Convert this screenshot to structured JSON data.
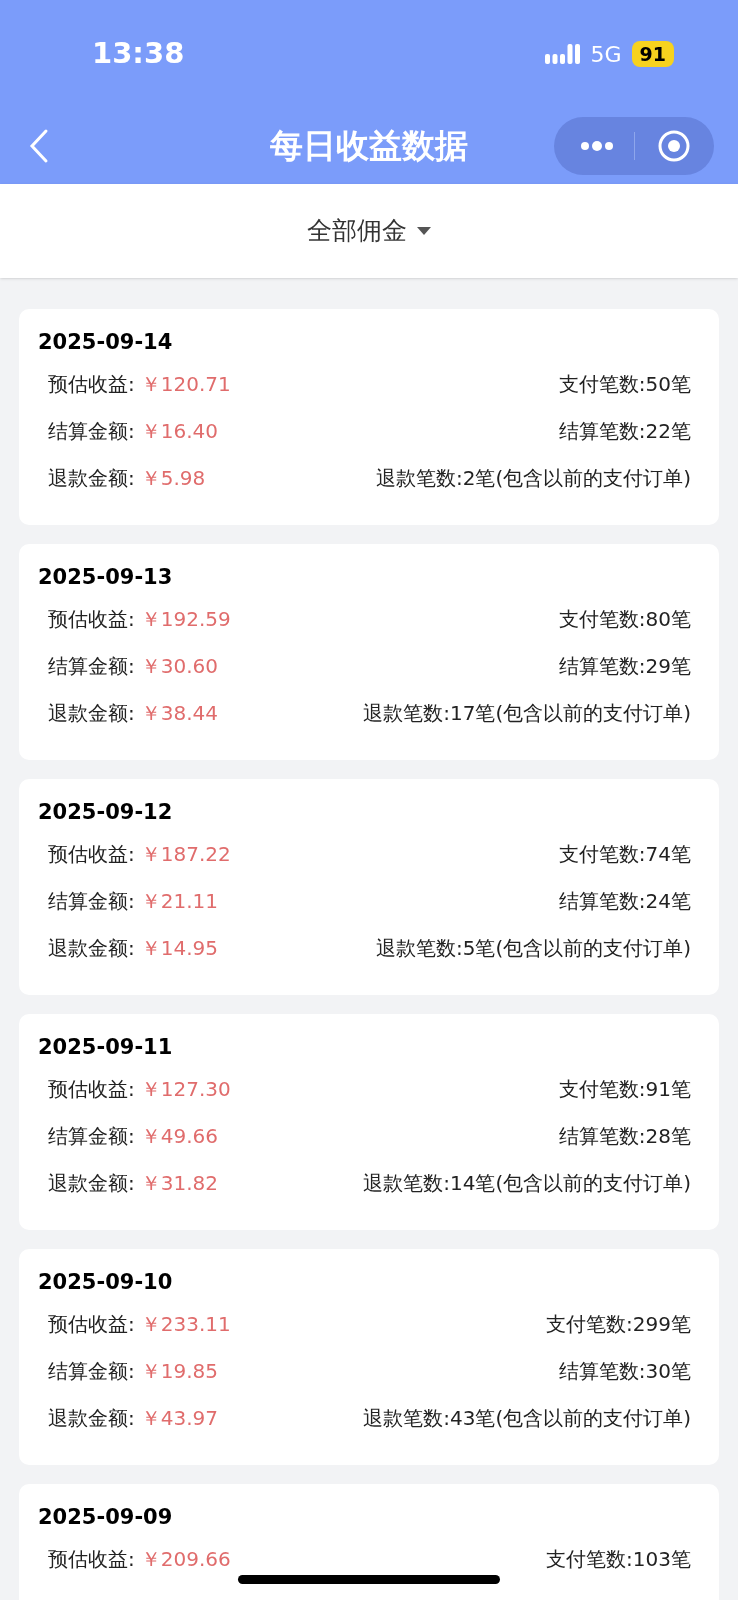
{
  "status_bar": {
    "time": "13:38",
    "network": "5G",
    "battery": "91"
  },
  "nav": {
    "title": "每日收益数据"
  },
  "filter": {
    "label": "全部佣金"
  },
  "days": [
    {
      "date": "2025-09-14",
      "rows": [
        {
          "label": "预估收益:",
          "value": "￥120.71",
          "count": "支付笔数:50笔"
        },
        {
          "label": "结算金额:",
          "value": "￥16.40",
          "count": "结算笔数:22笔"
        },
        {
          "label": "退款金额:",
          "value": "￥5.98",
          "count": "退款笔数:2笔(包含以前的支付订单)"
        }
      ]
    },
    {
      "date": "2025-09-13",
      "rows": [
        {
          "label": "预估收益:",
          "value": "￥192.59",
          "count": "支付笔数:80笔"
        },
        {
          "label": "结算金额:",
          "value": "￥30.60",
          "count": "结算笔数:29笔"
        },
        {
          "label": "退款金额:",
          "value": "￥38.44",
          "count": "退款笔数:17笔(包含以前的支付订单)"
        }
      ]
    },
    {
      "date": "2025-09-12",
      "rows": [
        {
          "label": "预估收益:",
          "value": "￥187.22",
          "count": "支付笔数:74笔"
        },
        {
          "label": "结算金额:",
          "value": "￥21.11",
          "count": "结算笔数:24笔"
        },
        {
          "label": "退款金额:",
          "value": "￥14.95",
          "count": "退款笔数:5笔(包含以前的支付订单)"
        }
      ]
    },
    {
      "date": "2025-09-11",
      "rows": [
        {
          "label": "预估收益:",
          "value": "￥127.30",
          "count": "支付笔数:91笔"
        },
        {
          "label": "结算金额:",
          "value": "￥49.66",
          "count": "结算笔数:28笔"
        },
        {
          "label": "退款金额:",
          "value": "￥31.82",
          "count": "退款笔数:14笔(包含以前的支付订单)"
        }
      ]
    },
    {
      "date": "2025-09-10",
      "rows": [
        {
          "label": "预估收益:",
          "value": "￥233.11",
          "count": "支付笔数:299笔"
        },
        {
          "label": "结算金额:",
          "value": "￥19.85",
          "count": "结算笔数:30笔"
        },
        {
          "label": "退款金额:",
          "value": "￥43.97",
          "count": "退款笔数:43笔(包含以前的支付订单)"
        }
      ]
    },
    {
      "date": "2025-09-09",
      "rows": [
        {
          "label": "预估收益:",
          "value": "￥209.66",
          "count": "支付笔数:103笔"
        }
      ]
    }
  ]
}
